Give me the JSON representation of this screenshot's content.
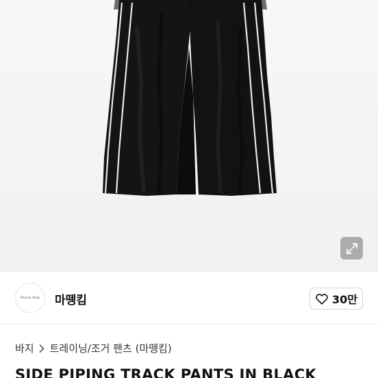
{
  "product_image": {
    "icon": "expand-icon"
  },
  "seller": {
    "avatar_text": "Matin Kim",
    "name": "마뗑킴",
    "like_icon": "heart-outline-icon",
    "like_count": "30만"
  },
  "breadcrumb": {
    "root": "바지",
    "separator_icon": "chevron-right-icon",
    "category": "트레이닝/조거 팬츠 (마뗑킴)"
  },
  "product": {
    "title": "SIDE PIPING TRACK PANTS IN BLACK"
  }
}
